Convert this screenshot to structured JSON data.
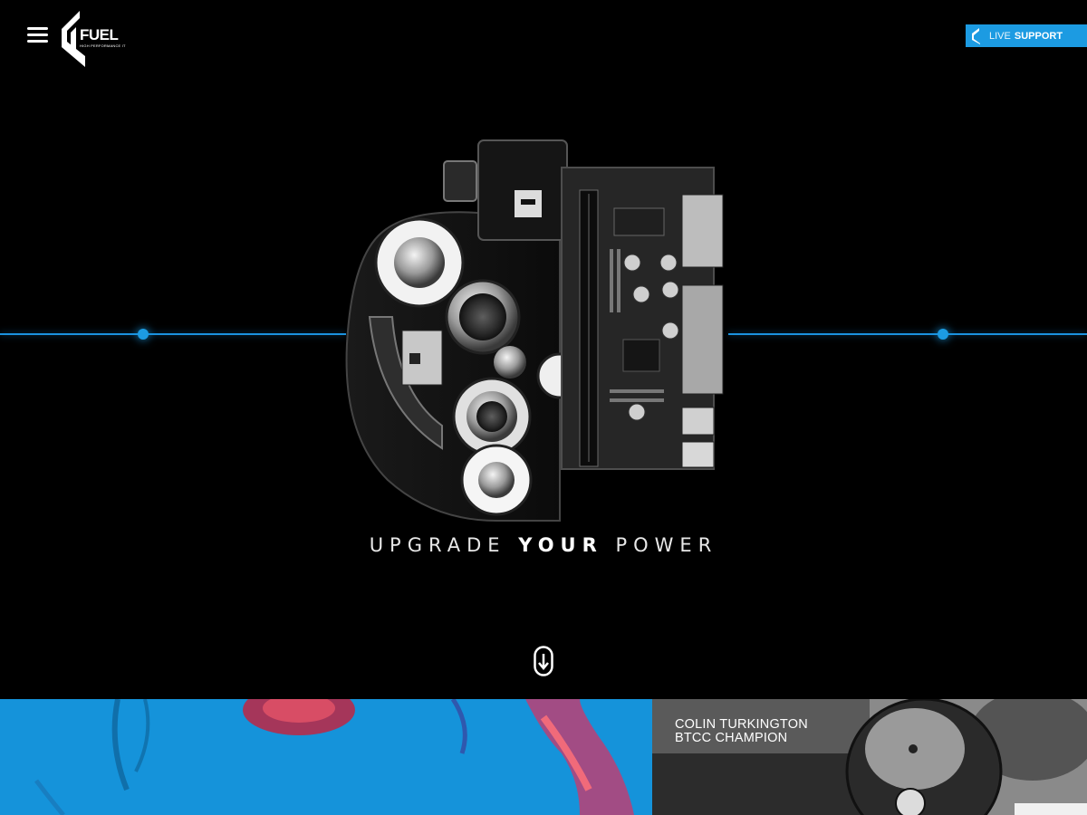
{
  "header": {
    "logo": {
      "word": "FUEL",
      "tagline": "HIGH PERFORMANCE IT"
    },
    "live_support": {
      "prefix": "LIVE",
      "bold": "SUPPORT"
    }
  },
  "hero": {
    "tagline": {
      "pre": "UPGRADE",
      "bold": "YOUR",
      "post": "POWER"
    }
  },
  "colors": {
    "accent": "#1c9be2",
    "background": "#000000"
  },
  "icons": {
    "menu": "hamburger-icon",
    "scroll": "scroll-down-arrow-icon",
    "flame": "fuel-flame-icon"
  },
  "tiles": [
    {
      "name": "ink-in-water-tile"
    },
    {
      "name": "btcc-champion-tile",
      "caption": [
        "COLIN TURKINGTON",
        "BTCC CHAMPION"
      ]
    }
  ]
}
